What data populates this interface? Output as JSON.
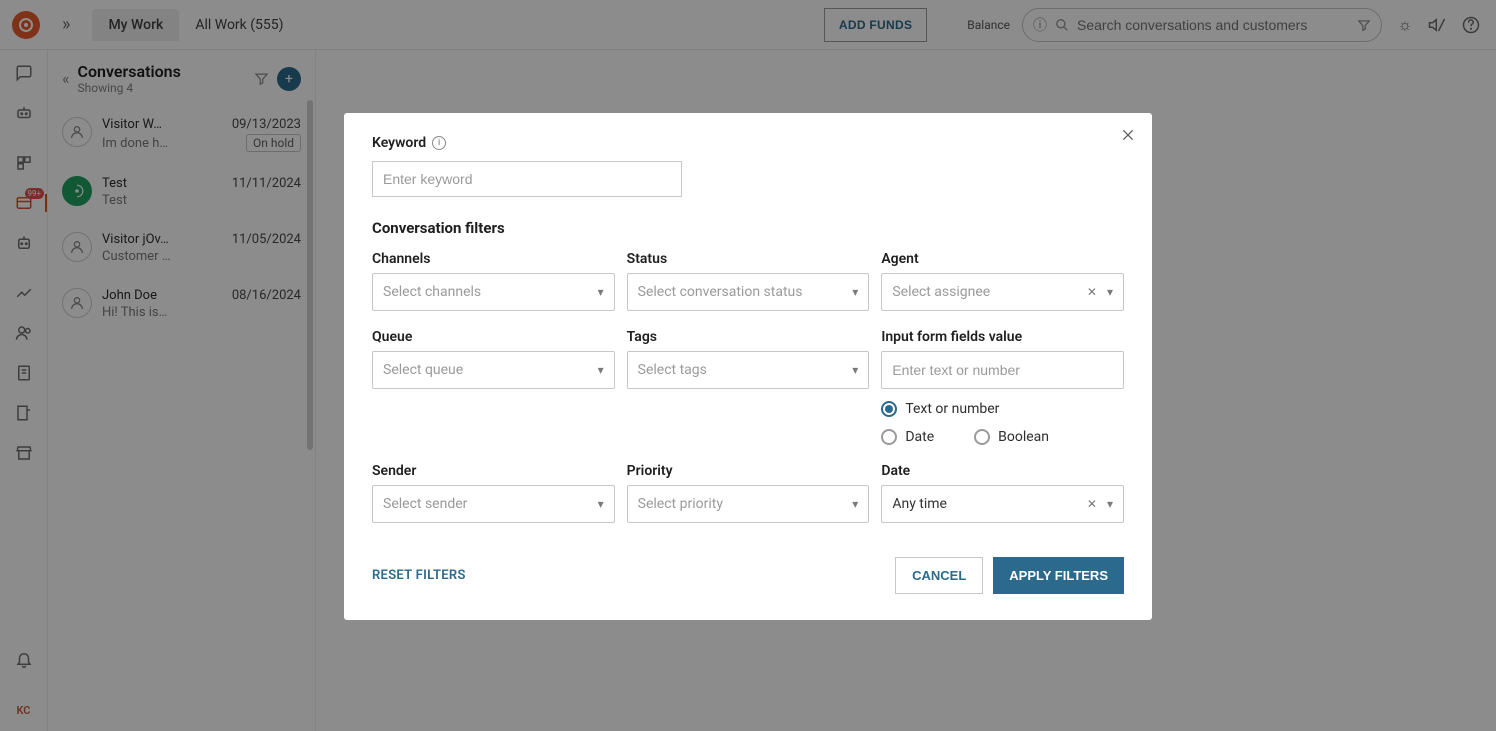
{
  "header": {
    "tabs": {
      "myWork": "My Work",
      "allWork": "All Work (555)"
    },
    "addFunds": "ADD FUNDS",
    "balance": "Balance",
    "searchPlaceholder": "Search conversations and customers"
  },
  "navRail": {
    "avatarInitials": "KC"
  },
  "convPanel": {
    "title": "Conversations",
    "subtitle": "Showing 4",
    "items": [
      {
        "name": "Visitor W…",
        "date": "09/13/2023",
        "preview": "Im done h…",
        "badge": "On hold",
        "avatar": "user"
      },
      {
        "name": "Test",
        "date": "11/11/2024",
        "preview": "Test",
        "badge": "",
        "avatar": "green"
      },
      {
        "name": "Visitor jOv…",
        "date": "11/05/2024",
        "preview": "Customer …",
        "badge": "",
        "avatar": "user"
      },
      {
        "name": "John Doe",
        "date": "08/16/2024",
        "preview": "Hi! This is…",
        "badge": "",
        "avatar": "user"
      }
    ]
  },
  "modal": {
    "keywordLabel": "Keyword",
    "keywordPlaceholder": "Enter keyword",
    "filtersTitle": "Conversation filters",
    "fields": {
      "channels": {
        "label": "Channels",
        "placeholder": "Select channels"
      },
      "status": {
        "label": "Status",
        "placeholder": "Select conversation status"
      },
      "agent": {
        "label": "Agent",
        "placeholder": "Select assignee"
      },
      "queue": {
        "label": "Queue",
        "placeholder": "Select queue"
      },
      "tags": {
        "label": "Tags",
        "placeholder": "Select tags"
      },
      "inputForm": {
        "label": "Input form fields value",
        "placeholder": "Enter text or number"
      },
      "sender": {
        "label": "Sender",
        "placeholder": "Select sender"
      },
      "priority": {
        "label": "Priority",
        "placeholder": "Select priority"
      },
      "date": {
        "label": "Date",
        "value": "Any time"
      }
    },
    "radios": {
      "textOrNumber": "Text or number",
      "date": "Date",
      "boolean": "Boolean"
    },
    "reset": "RESET FILTERS",
    "cancel": "CANCEL",
    "apply": "APPLY FILTERS"
  }
}
